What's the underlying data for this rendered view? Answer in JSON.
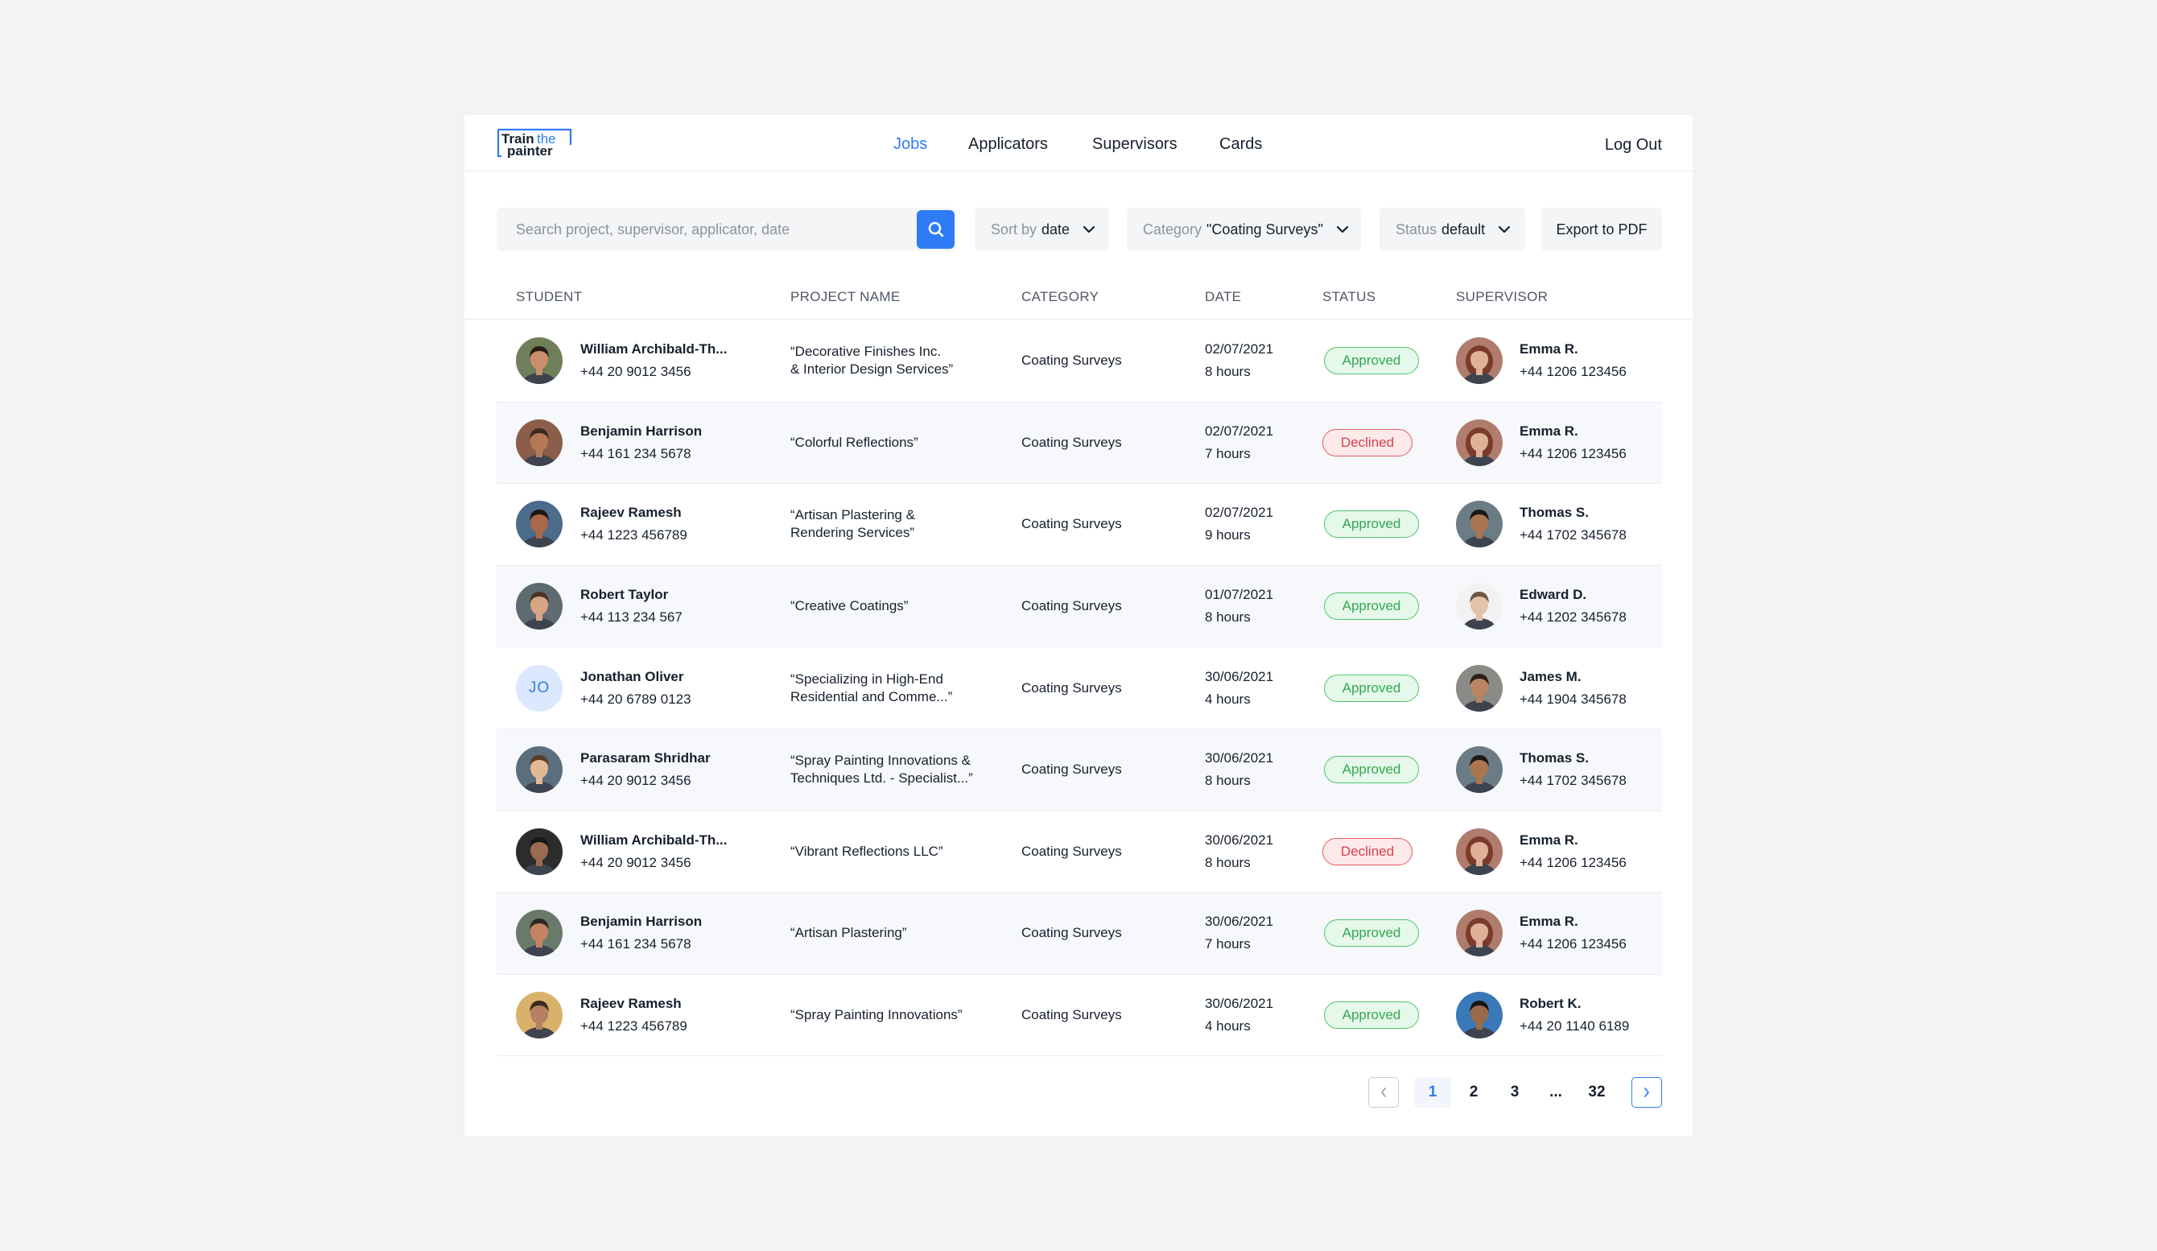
{
  "header": {
    "logo_top": "Train",
    "logo_the": "the",
    "logo_bottom": "painter",
    "nav": [
      {
        "label": "Jobs",
        "active": true
      },
      {
        "label": "Applicators",
        "active": false
      },
      {
        "label": "Supervisors",
        "active": false
      },
      {
        "label": "Cards",
        "active": false
      }
    ],
    "logout_label": "Log Out"
  },
  "toolbar": {
    "search_placeholder": "Search project, supervisor, applicator, date",
    "sort": {
      "label": "Sort by",
      "value": "date"
    },
    "category": {
      "label": "Category",
      "value": "\"Coating Surveys\""
    },
    "status": {
      "label": "Status",
      "value": "default"
    },
    "export_label": "Export to PDF"
  },
  "table": {
    "columns": [
      "STUDENT",
      "PROJECT NAME",
      "CATEGORY",
      "DATE",
      "STATUS",
      "SUPERVISOR"
    ],
    "rows": [
      {
        "student": "William Archibald-Th...",
        "student_phone": "+44 20 9012 3456",
        "project": [
          "“Decorative Finishes Inc.",
          "& Interior Design Services”"
        ],
        "category": "Coating Surveys",
        "date": "02/07/2021",
        "hours": "8 hours",
        "status": "Approved",
        "supervisor": "Emma R.",
        "supervisor_phone": "+44 1206 123456"
      },
      {
        "student": "Benjamin Harrison",
        "student_phone": "+44 161 234 5678",
        "project": [
          "“Colorful Reflections”"
        ],
        "category": "Coating Surveys",
        "date": "02/07/2021",
        "hours": "7 hours",
        "status": "Declined",
        "supervisor": "Emma R.",
        "supervisor_phone": "+44 1206 123456"
      },
      {
        "student": "Rajeev Ramesh",
        "student_phone": "+44 1223 456789",
        "project": [
          "“Artisan Plastering &",
          "Rendering Services”"
        ],
        "category": "Coating Surveys",
        "date": "02/07/2021",
        "hours": "9 hours",
        "status": "Approved",
        "supervisor": "Thomas S.",
        "supervisor_phone": "+44 1702 345678"
      },
      {
        "student": "Robert Taylor",
        "student_phone": "+44 113 234 567",
        "project": [
          "“Creative Coatings”"
        ],
        "category": "Coating Surveys",
        "date": "01/07/2021",
        "hours": "8 hours",
        "status": "Approved",
        "supervisor": "Edward D.",
        "supervisor_phone": "+44 1202 345678"
      },
      {
        "student": "Jonathan Oliver",
        "student_initials": "JO",
        "student_phone": "+44 20 6789 0123",
        "project": [
          "“Specializing in High-End",
          "Residential and Comme...”"
        ],
        "category": "Coating Surveys",
        "date": "30/06/2021",
        "hours": "4 hours",
        "status": "Approved",
        "supervisor": "James M.",
        "supervisor_phone": "+44 1904 345678"
      },
      {
        "student": "Parasaram Shridhar",
        "student_phone": "+44 20 9012 3456",
        "project": [
          "“Spray Painting Innovations &",
          "Techniques Ltd. - Specialist...”"
        ],
        "category": "Coating Surveys",
        "date": "30/06/2021",
        "hours": "8 hours",
        "status": "Approved",
        "supervisor": "Thomas S.",
        "supervisor_phone": "+44 1702 345678"
      },
      {
        "student": "William Archibald-Th...",
        "student_phone": "+44 20 9012 3456",
        "project": [
          "“Vibrant Reflections LLC”"
        ],
        "category": "Coating Surveys",
        "date": "30/06/2021",
        "hours": "8 hours",
        "status": "Declined",
        "supervisor": "Emma R.",
        "supervisor_phone": "+44 1206 123456"
      },
      {
        "student": "Benjamin Harrison",
        "student_phone": "+44 161 234 5678",
        "project": [
          "“Artisan Plastering”"
        ],
        "category": "Coating Surveys",
        "date": "30/06/2021",
        "hours": "7 hours",
        "status": "Approved",
        "supervisor": "Emma R.",
        "supervisor_phone": "+44 1206 123456"
      },
      {
        "student": "Rajeev Ramesh",
        "student_phone": "+44 1223 456789",
        "project": [
          "“Spray Painting Innovations”"
        ],
        "category": "Coating Surveys",
        "date": "30/06/2021",
        "hours": "4 hours",
        "status": "Approved",
        "supervisor": "Robert K.",
        "supervisor_phone": "+44 20 1140 6189"
      }
    ]
  },
  "pagination": {
    "pages": [
      "1",
      "2",
      "3",
      "...",
      "32"
    ],
    "current": "1"
  },
  "colors": {
    "accent": "#2f7bf5",
    "approved": "#34a853",
    "declined": "#d93f49"
  },
  "icons": [
    "search-icon",
    "chevron-down-icon",
    "chevron-left-icon",
    "chevron-right-icon",
    "avatar"
  ]
}
